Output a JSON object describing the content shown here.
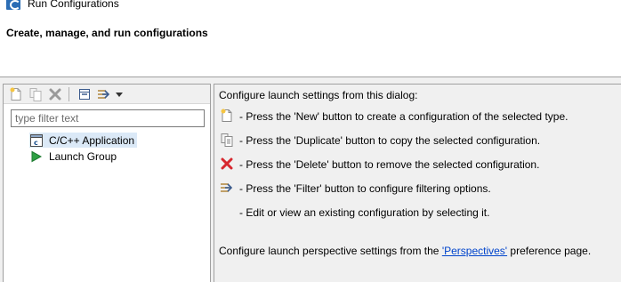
{
  "window": {
    "title": "Run Configurations"
  },
  "banner": {
    "title": "Create, manage, and run configurations"
  },
  "filter": {
    "placeholder": "type filter text",
    "value": ""
  },
  "toolbar": {
    "buttons": [
      {
        "name": "new-launch-configuration-button",
        "icon": "new-document-icon"
      },
      {
        "name": "duplicate-button",
        "icon": "duplicate-icon"
      },
      {
        "name": "delete-button",
        "icon": "delete-x-icon"
      },
      {
        "name": "collapse-all-button",
        "icon": "collapse-all-icon"
      },
      {
        "name": "filter-button",
        "icon": "filter-icon"
      },
      {
        "name": "view-menu-button",
        "icon": "chevron-down-icon"
      }
    ]
  },
  "tree": {
    "items": [
      {
        "label": "C/C++ Application",
        "icon": "c-application-icon",
        "selected": true
      },
      {
        "label": "Launch Group",
        "icon": "launch-group-icon",
        "selected": false
      }
    ]
  },
  "help": {
    "intro": "Configure launch settings from this dialog:",
    "lines": [
      {
        "icon": "new-document-icon",
        "text": "- Press the 'New' button to create a configuration of the selected type."
      },
      {
        "icon": "duplicate-icon",
        "text": "- Press the 'Duplicate' button to copy the selected configuration."
      },
      {
        "icon": "delete-x-icon",
        "text": "- Press the 'Delete' button to remove the selected configuration."
      },
      {
        "icon": "filter-icon",
        "text": "- Press the 'Filter' button to configure filtering options."
      },
      {
        "icon": "",
        "text": "- Edit or view an existing configuration by selecting it."
      }
    ],
    "perspectives_prefix": "Configure launch perspective settings from the ",
    "perspectives_link": "'Perspectives'",
    "perspectives_suffix": " preference page."
  },
  "colors": {
    "selection": "#dbe9f7",
    "delete_red": "#d7282f",
    "link": "#0044cc",
    "panel_bg": "#f0f0f0"
  }
}
